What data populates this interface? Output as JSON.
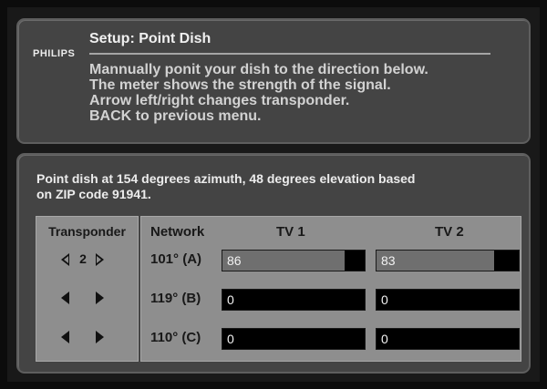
{
  "brand": "PHILIPS",
  "title": "Setup: Point Dish",
  "instructions": [
    "Mannually ponit your dish to the direction below.",
    "The meter shows the strength of the signal.",
    "Arrow left/right changes transponder.",
    "BACK to previous menu."
  ],
  "pointing": {
    "line1": "Point dish at 154 degrees azimuth, 48 degrees elevation based",
    "line2": "on ZIP code 91941."
  },
  "transponder": {
    "title": "Transponder",
    "rows": [
      {
        "value": "2",
        "active": true
      },
      {
        "value": "",
        "active": false
      },
      {
        "value": "",
        "active": false
      }
    ]
  },
  "network": {
    "header": "Network",
    "tv1_header": "TV 1",
    "tv2_header": "TV 2",
    "rows": [
      {
        "label": "101° (A)",
        "tv1": "86",
        "tv2": "83",
        "tv1_level": 0.86,
        "tv2_level": 0.83
      },
      {
        "label": "119° (B)",
        "tv1": "0",
        "tv2": "0",
        "tv1_level": 0,
        "tv2_level": 0
      },
      {
        "label": "110° (C)",
        "tv1": "0",
        "tv2": "0",
        "tv1_level": 0,
        "tv2_level": 0
      }
    ]
  },
  "colors": {
    "panel": "#444444",
    "box": "#8e8e8e",
    "meter_fill": "#6f6f6f",
    "meter_bg": "#000000"
  }
}
